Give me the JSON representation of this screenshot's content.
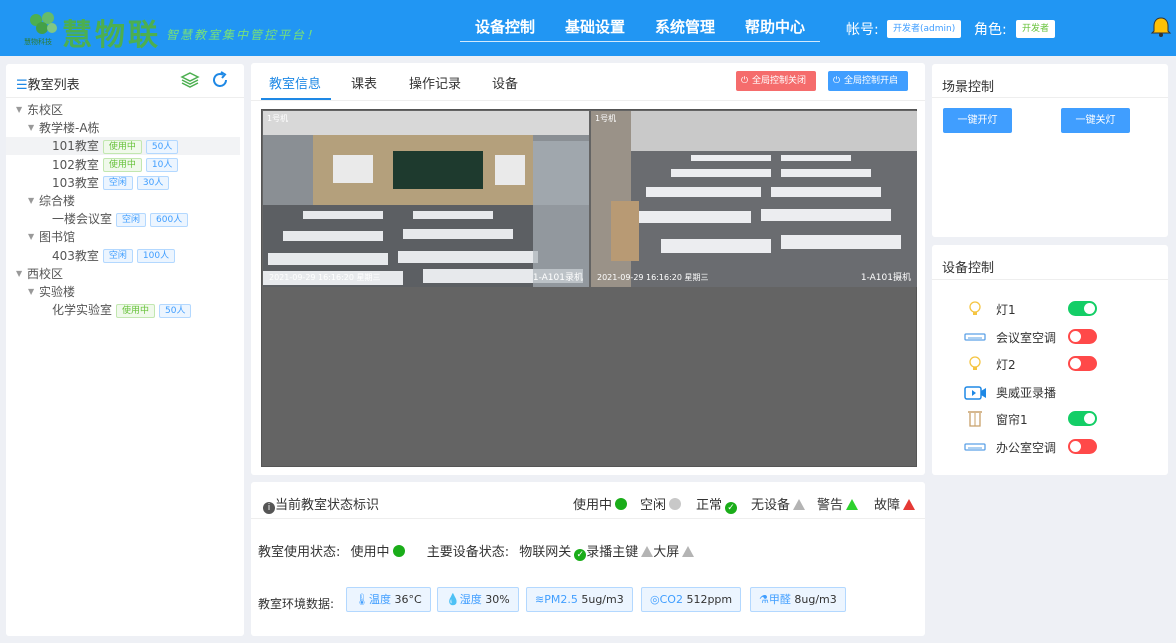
{
  "header": {
    "brand_small": "慧物科技",
    "brand": "慧物联",
    "slogan": "智慧教室集中管控平台！",
    "nav": [
      "设备控制",
      "基础设置",
      "系统管理",
      "帮助中心"
    ],
    "account_label": "帐号:",
    "account_value": "开发者(admin)",
    "role_label": "角色:",
    "role_value": "开发者"
  },
  "sidebar": {
    "title": "教室列表",
    "tree": [
      {
        "level": 0,
        "label": "东校区",
        "arrow": true
      },
      {
        "level": 1,
        "label": "教学楼-A栋",
        "arrow": true
      },
      {
        "level": 2,
        "label": "101教室",
        "status": "使用中",
        "cap": "50人",
        "selected": true
      },
      {
        "level": 2,
        "label": "102教室",
        "status": "使用中",
        "cap": "10人"
      },
      {
        "level": 2,
        "label": "103教室",
        "status": "空闲",
        "cap": "30人"
      },
      {
        "level": 1,
        "label": "综合楼",
        "arrow": true
      },
      {
        "level": 2,
        "label": "一楼会议室",
        "status": "空闲",
        "cap": "600人"
      },
      {
        "level": 1,
        "label": "图书馆",
        "arrow": true
      },
      {
        "level": 2,
        "label": "403教室",
        "status": "空闲",
        "cap": "100人"
      },
      {
        "level": 0,
        "label": "西校区",
        "arrow": true
      },
      {
        "level": 1,
        "label": "实验楼",
        "arrow": true
      },
      {
        "level": 2,
        "label": "化学实验室",
        "status": "使用中",
        "cap": "50人"
      }
    ]
  },
  "main": {
    "tabs": [
      "教室信息",
      "课表",
      "操作记录",
      "设备"
    ],
    "btn_close_all": "全局控制关闭",
    "btn_open_all": "全局控制开启",
    "cams": [
      {
        "corner": "1号机",
        "timestamp": "2021-09-29 16:16:20 星期三",
        "name": "1-A101录机"
      },
      {
        "corner": "1号机",
        "timestamp": "2021-09-29 16:16:20 星期三",
        "name": "1-A101摄机"
      }
    ]
  },
  "status": {
    "title": "当前教室状态标识",
    "legend": [
      {
        "label": "使用中",
        "kind": "dot",
        "color": "#1aad19"
      },
      {
        "label": "空闲",
        "kind": "dot",
        "color": "#c8c8c8"
      },
      {
        "label": "正常",
        "kind": "check",
        "color": "#1aad19"
      },
      {
        "label": "无设备",
        "kind": "tri",
        "color": "#b4b4b4"
      },
      {
        "label": "警告",
        "kind": "tri",
        "color": "#2ed12e"
      },
      {
        "label": "故障",
        "kind": "tri",
        "color": "#e53935"
      }
    ],
    "usage_label": "教室使用状态:",
    "usage_value": "使用中",
    "device_label": "主要设备状态:",
    "devices": [
      "物联网关",
      "录播主键",
      "大屏"
    ],
    "env_label": "教室环境数据:",
    "env": [
      {
        "k": "温度",
        "v": "36°C"
      },
      {
        "k": "湿度",
        "v": "30%"
      },
      {
        "k": "PM2.5",
        "v": "5ug/m3"
      },
      {
        "k": "CO2",
        "v": "512ppm"
      },
      {
        "k": "甲醛",
        "v": "8ug/m3"
      }
    ]
  },
  "scene": {
    "title": "场景控制",
    "btn_on": "一键开灯",
    "btn_off": "一键关灯"
  },
  "devices": {
    "title": "设备控制",
    "items": [
      {
        "label": "灯1",
        "icon": "bulb-icon",
        "state": "on"
      },
      {
        "label": "会议室空调",
        "icon": "aircon-icon",
        "state": "off"
      },
      {
        "label": "灯2",
        "icon": "bulb-icon",
        "state": "off"
      },
      {
        "label": "奥威亚录播",
        "icon": "camera-icon",
        "state": null
      },
      {
        "label": "窗帘1",
        "icon": "curtain-icon",
        "state": "on"
      },
      {
        "label": "办公室空调",
        "icon": "aircon-icon",
        "state": "off"
      }
    ]
  }
}
